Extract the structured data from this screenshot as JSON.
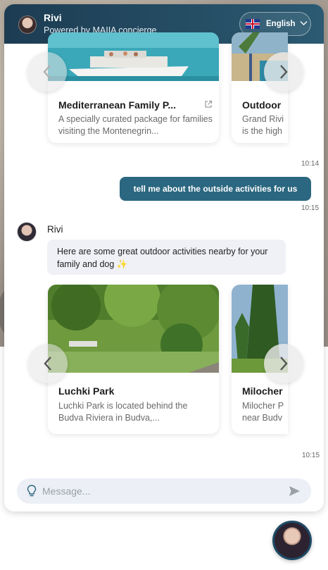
{
  "header": {
    "title": "Rivi",
    "subtitle": "Powered by MAIIA concierge",
    "language": "English"
  },
  "carousel_top": {
    "cards": [
      {
        "title": "Mediterranean Family P...",
        "description": "A specially curated package for families visiting the Montenegrin..."
      },
      {
        "title": "Outdoor",
        "description": "Grand Rivi is the high"
      }
    ],
    "time": "10:14"
  },
  "user_message": {
    "text": "tell me about the outside activities for us",
    "time": "10:15"
  },
  "bot_message": {
    "name": "Rivi",
    "text": "Here are some great outdoor activities nearby for your family and dog ✨"
  },
  "carousel_bottom": {
    "cards": [
      {
        "title": "Luchki Park",
        "description": "Luchki Park is located behind the Budva Riviera in Budva,..."
      },
      {
        "title": "Milocher",
        "description": "Milocher P near Budv"
      }
    ],
    "time": "10:15"
  },
  "composer": {
    "placeholder": "Message..."
  },
  "colors": {
    "header_start": "#1c3c52",
    "header_end": "#2b5a72",
    "user_bubble": "#2b6780",
    "bot_bubble": "#eff1f6"
  }
}
